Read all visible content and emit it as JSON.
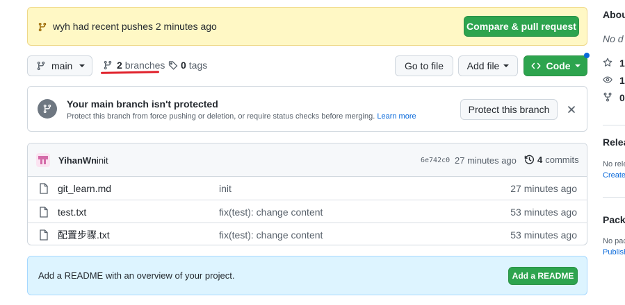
{
  "push_banner": {
    "message": "wyh had recent pushes 2 minutes ago",
    "button": "Compare & pull request"
  },
  "toolbar": {
    "branch": "main",
    "branch_count": "2",
    "branches_label": "branches",
    "tag_count": "0",
    "tags_label": "tags",
    "go_to_file": "Go to file",
    "add_file": "Add file",
    "code": "Code"
  },
  "protect": {
    "title": "Your main branch isn't protected",
    "desc": "Protect this branch from force pushing or deletion, or require status checks before merging.",
    "learn_more": "Learn more",
    "button": "Protect this branch"
  },
  "commit": {
    "author": "YihanWn",
    "message": "init",
    "sha": "6e742c0",
    "time": "27 minutes ago",
    "count": "4",
    "count_label": "commits"
  },
  "files": [
    {
      "name": "git_learn.md",
      "message": "init",
      "time": "27 minutes ago"
    },
    {
      "name": "test.txt",
      "message": "fix(test): change content",
      "time": "53 minutes ago"
    },
    {
      "name": "配置步骤.txt",
      "message": "fix(test): change content",
      "time": "53 minutes ago"
    }
  ],
  "readme": {
    "text": "Add a README with an overview of your project.",
    "button": "Add a README"
  },
  "sidebar": {
    "about": "About",
    "no_desc": "No d",
    "stars": "1",
    "watchers": "1",
    "forks": "0",
    "releases": "Relea",
    "no_releases": "No rele",
    "create": "Create",
    "packages": "Packa",
    "no_packages": "No pac",
    "publish": "Publish"
  },
  "colors": {
    "accent_green": "#2da44e",
    "link_blue": "#0969da",
    "banner_bg": "#fff8c5",
    "readme_bg": "#ddf4ff",
    "annotation_red": "#e0202a"
  }
}
